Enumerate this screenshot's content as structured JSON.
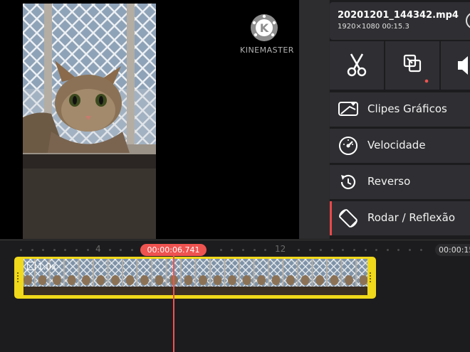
{
  "preview": {
    "watermark_text": "KINEMASTER",
    "watermark_letter": "K",
    "watermark_icon": "kinemaster-logo-icon",
    "photo_icon": "cat-photo"
  },
  "file": {
    "name": "20201201_144342.mp4",
    "meta": "1920×1080  00:15.3",
    "info_icon": "info-icon"
  },
  "tools": [
    {
      "name": "scissors-icon"
    },
    {
      "name": "crop-icon",
      "has_dot": true
    },
    {
      "name": "volume-icon"
    }
  ],
  "menu": {
    "clipes": {
      "label": "Clipes Gráficos",
      "icon": "graphic-clips-icon"
    },
    "velocidade": {
      "label": "Velocidade",
      "icon": "speedometer-icon"
    },
    "reverso": {
      "label": "Reverso",
      "icon": "reverse-icon"
    },
    "rodar": {
      "label": "Rodar / Reflexão",
      "icon": "rotate-icon",
      "selected": true
    }
  },
  "timeline": {
    "tick_4": "4",
    "tick_12": "12",
    "current_time": "00:00:06.741",
    "end_time": "00:00:15",
    "clip_speed": "1.0x"
  },
  "colors": {
    "accent": "#ef5350",
    "clip_border": "#f0d81a",
    "panel_bg": "#2f2f33"
  }
}
